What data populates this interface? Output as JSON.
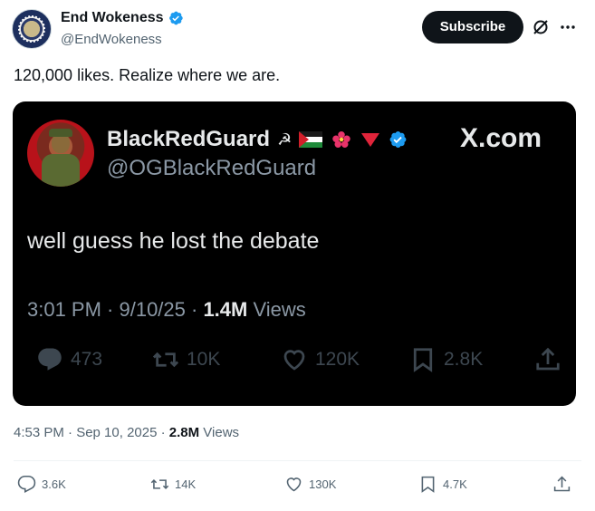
{
  "author": {
    "name": "End Wokeness",
    "handle": "@EndWokeness"
  },
  "subscribe_label": "Subscribe",
  "tweet_text": "120,000 likes. Realize where we are.",
  "quoted_card": {
    "name": "BlackRedGuard",
    "emoji_symbols": "☭",
    "handle": "@OGBlackRedGuard",
    "brand": "X.com",
    "text": "well guess he lost the debate",
    "meta_time": "3:01 PM · 9/10/25 · ",
    "meta_views_count": "1.4M",
    "meta_views_label": " Views",
    "actions": {
      "replies": "473",
      "reposts": "10K",
      "likes": "120K",
      "bookmarks": "2.8K"
    }
  },
  "post_meta": {
    "time": "4:53 PM · Sep 10, 2025 · ",
    "views_count": "2.8M",
    "views_label": " Views"
  },
  "actions": {
    "replies": "3.6K",
    "reposts": "14K",
    "likes": "130K",
    "bookmarks": "4.7K"
  },
  "colors": {
    "text_primary": "#0f1419",
    "text_secondary": "#536471",
    "verified_blue": "#1d9bf0",
    "card_bg": "#000000"
  }
}
